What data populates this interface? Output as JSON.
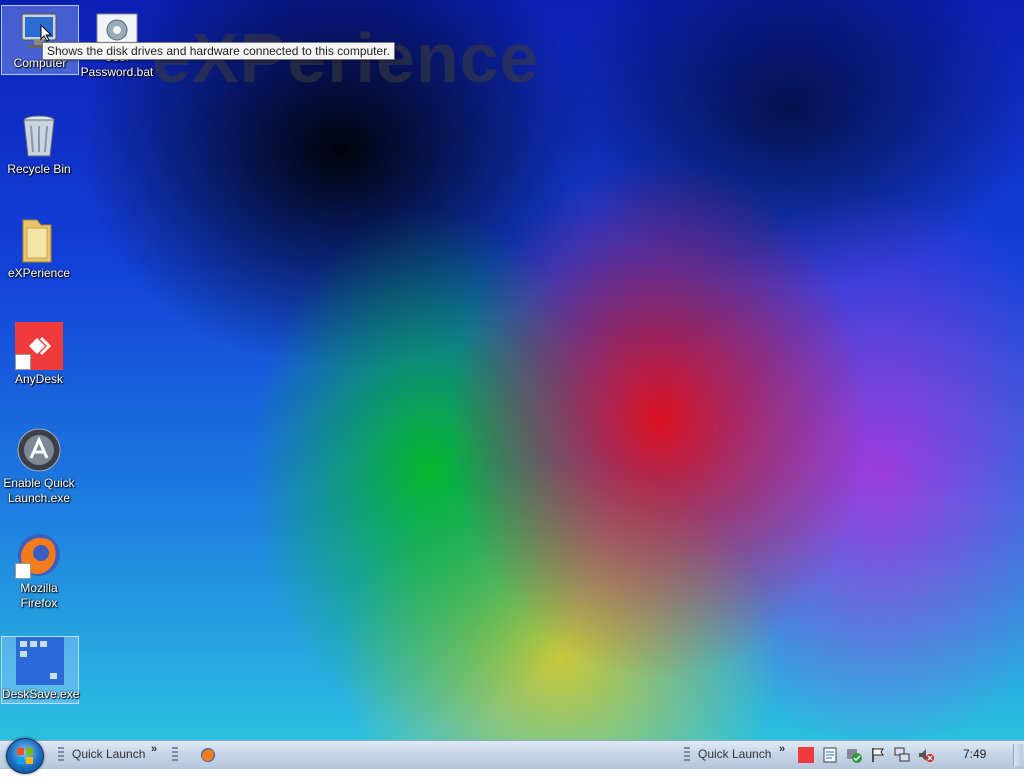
{
  "desktop": {
    "watermark": "eXPerience",
    "icons": [
      {
        "label": "Computer",
        "name": "computer-icon"
      },
      {
        "label": "User Password.bat",
        "name": "batch-file-icon"
      },
      {
        "label": "Recycle Bin",
        "name": "recycle-bin-icon"
      },
      {
        "label": "eXPerience",
        "name": "folder-icon"
      },
      {
        "label": "AnyDesk",
        "name": "anydesk-icon"
      },
      {
        "label": "Enable Quick Launch.exe",
        "name": "quick-launch-exe-icon"
      },
      {
        "label": "Mozilla Firefox",
        "name": "firefox-icon"
      },
      {
        "label": "DeskSave.exe",
        "name": "desksave-icon"
      }
    ],
    "tooltip": "Shows the disk drives and hardware connected to this computer."
  },
  "taskbar": {
    "start_icon": "windows-logo-icon",
    "quick_launch_left": "Quick Launch",
    "chevron": "»",
    "quick_launch_right": "Quick Launch",
    "clock": "7:49",
    "tray_icons": [
      "anydesk-tray-icon",
      "clipboard-icon",
      "security-icon",
      "action-center-flag-icon",
      "network-icon",
      "volume-muted-icon"
    ]
  },
  "colors": {
    "accent": "#1c6cc0",
    "taskbar": "#c4d4e6"
  }
}
